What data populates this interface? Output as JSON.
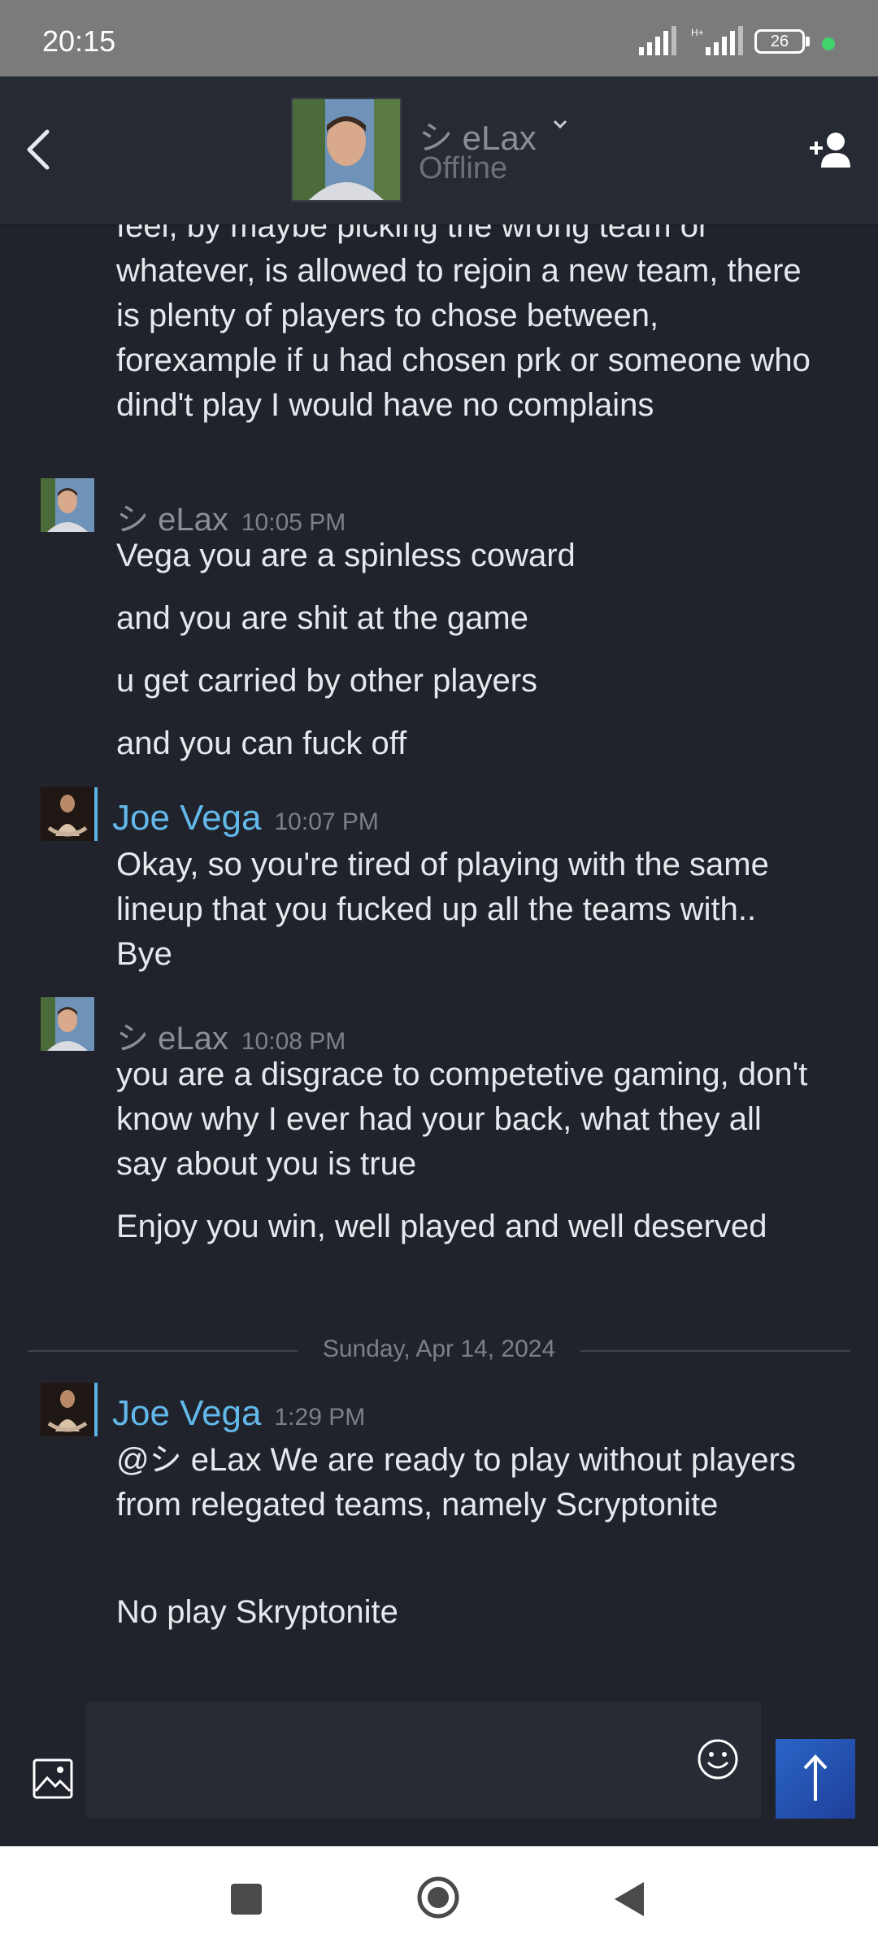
{
  "status_bar": {
    "time": "20:15",
    "battery": "26",
    "network": "H+"
  },
  "header": {
    "contact_name": "シ eLax",
    "contact_status": "Offline"
  },
  "messages": {
    "partial": {
      "text": "feel, by maybe picking the wrong team or whatever, is allowed to rejoin a new team, there is plenty of players to chose between, forexample if u had chosen prk or someone who dind't play I would have no complains"
    },
    "g1": {
      "author": "シ eLax",
      "time": "10:05 PM",
      "lines": [
        "Vega you are a spinless coward",
        "and you are shit at the game",
        "u get carried by other players",
        "and you can fuck off"
      ]
    },
    "g2": {
      "author": "Joe Vega",
      "time": "10:07 PM",
      "lines": [
        "Okay, so you're tired of playing with the same lineup that you fucked up all the teams with.. Bye"
      ]
    },
    "g3": {
      "author": "シ eLax",
      "time": "10:08 PM",
      "lines": [
        "you are a disgrace to competetive gaming, don't know why I ever had your back, what they all say about you is true",
        "Enjoy you win, well played and well deserved"
      ]
    },
    "date_separator": "Sunday, Apr 14, 2024",
    "g4": {
      "author": "Joe Vega",
      "time": "1:29 PM",
      "lines": [
        "@シ eLax We are ready to play without players from relegated teams, namely Scryptonite",
        "No play Skryptonite"
      ]
    }
  },
  "composer": {
    "placeholder": ""
  },
  "colors": {
    "background": "#20232b",
    "header": "#262a33",
    "accent_name": "#62b8ea",
    "send_button": "#2a65c7"
  },
  "icons": [
    "back-icon",
    "chevron-down-icon",
    "add-friend-icon",
    "image-icon",
    "emoji-icon",
    "send-arrow-icon",
    "nav-recents-icon",
    "nav-home-icon",
    "nav-back-icon"
  ]
}
